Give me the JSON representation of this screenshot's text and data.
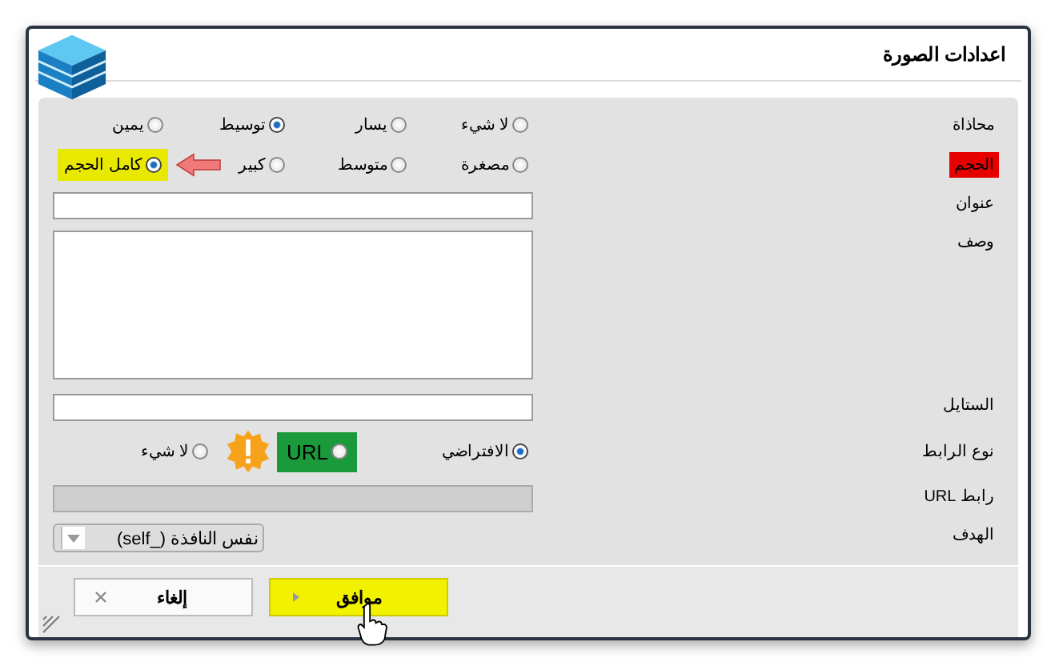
{
  "dialog": {
    "title": "اعدادات الصورة"
  },
  "alignment": {
    "label": "محاذاة",
    "options": [
      {
        "label": "لا شيء",
        "selected": false
      },
      {
        "label": "يسار",
        "selected": false
      },
      {
        "label": "توسيط",
        "selected": true
      },
      {
        "label": "يمين",
        "selected": false
      }
    ]
  },
  "size": {
    "label": "الحجم",
    "color": "#e60000",
    "options": [
      {
        "label": "مصغرة",
        "selected": false
      },
      {
        "label": "متوسط",
        "selected": false
      },
      {
        "label": "كبير",
        "selected": false
      },
      {
        "label": "كامل الحجم",
        "selected": true,
        "color": "#e8e800",
        "pointer": true
      }
    ]
  },
  "title_field": {
    "label": "عنوان"
  },
  "description_field": {
    "label": "وصف"
  },
  "style_field": {
    "label": "الستايل"
  },
  "link_type": {
    "label": "نوع الرابط",
    "options": [
      {
        "label": "الافتراضي",
        "selected": true
      },
      {
        "label": "URL",
        "selected": false,
        "color": "#1a9a3a",
        "warning": true
      },
      {
        "label": "لا شيء",
        "selected": false
      }
    ]
  },
  "url_field": {
    "label": "رابط URL",
    "disabled": true
  },
  "target": {
    "label": "الهدف",
    "value": "نفس النافذة (_self)"
  },
  "buttons": [
    {
      "kind": "ok",
      "label": "موافق",
      "color": "#f2f200"
    },
    {
      "kind": "cancel",
      "label": "إلغاء"
    }
  ]
}
